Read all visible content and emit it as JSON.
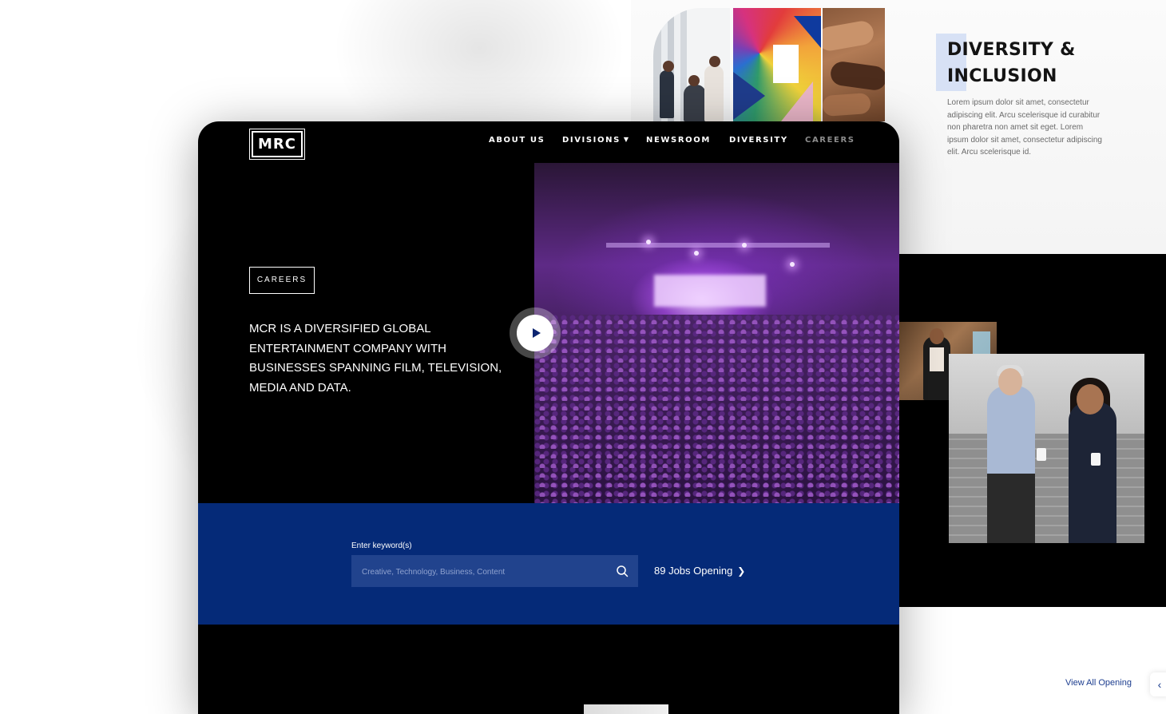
{
  "brand": {
    "logo": "MRC"
  },
  "nav": {
    "items": [
      {
        "label": "ABOUT US"
      },
      {
        "label": "DIVISIONS"
      },
      {
        "label": "NEWSROOM"
      },
      {
        "label": "DIVERSITY"
      },
      {
        "label": "CAREERS"
      }
    ],
    "divisions_icon": "caret-down-icon"
  },
  "hero": {
    "tag": "CAREERS",
    "text": "MCR IS A DIVERSIFIED GLOBAL ENTERTAINMENT COMPANY WITH BUSINESSES SPANNING FILM, TELEVISION, MEDIA AND DATA.",
    "play_icon": "play-icon"
  },
  "search": {
    "label": "Enter keyword(s)",
    "placeholder": "Creative, Technology, Business, Content",
    "value": "",
    "icon": "search-icon",
    "jobs_link": "89 Jobs Opening",
    "jobs_icon": "chevron-right-icon"
  },
  "diversity": {
    "title": "DIVERSITY & INCLUSION",
    "body": "Lorem ipsum dolor sit amet, consectetur adipiscing elit. Arcu scelerisque id curabitur non pharetra non amet sit eget. Lorem ipsum dolor sit amet, consectetur adipiscing elit. Arcu scelerisque id."
  },
  "openings": {
    "view_all": "View All Opening",
    "arrow_icon": "chevron-left-icon"
  },
  "colors": {
    "search_band": "#052a78",
    "search_box": "#21438d",
    "link_blue": "#1c3d8f",
    "accent_light": "#d7e1f5",
    "nav_muted": "#8c8c8c"
  }
}
